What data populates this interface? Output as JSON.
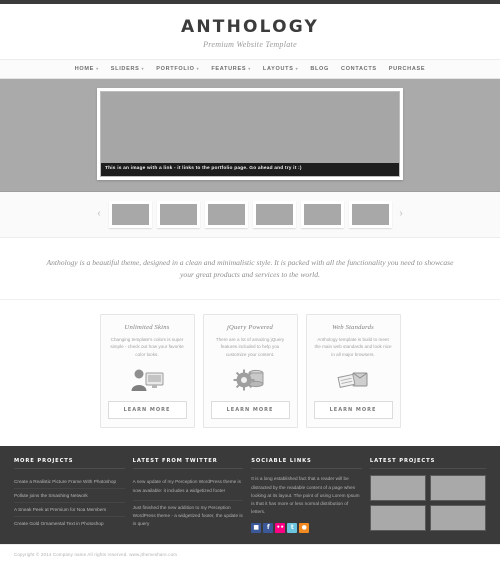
{
  "header": {
    "logo": "ANTHOLOGY",
    "tagline": "Premium Website Template"
  },
  "nav": {
    "items": [
      {
        "label": "HOME",
        "has_dropdown": true
      },
      {
        "label": "SLIDERS",
        "has_dropdown": true
      },
      {
        "label": "PORTFOLIO",
        "has_dropdown": true
      },
      {
        "label": "FEATURES",
        "has_dropdown": true
      },
      {
        "label": "LAYOUTS",
        "has_dropdown": true
      },
      {
        "label": "BLOG",
        "has_dropdown": false
      },
      {
        "label": "CONTACTS",
        "has_dropdown": false
      },
      {
        "label": "PURCHASE",
        "has_dropdown": false
      }
    ],
    "caret": "▾"
  },
  "hero": {
    "caption": "This is an image with a link - it links to the portfolio page. Go ahead and try it :)"
  },
  "carousel": {
    "prev": "‹",
    "next": "›",
    "thumb_count": 6
  },
  "intro": {
    "text": "Anthology is a beautiful theme, designed in a clean and minimalistic style. It is packed with all the functionality you need to showcase your great products and services to the world."
  },
  "features": {
    "boxes": [
      {
        "title": "Unlimited Skins",
        "text": "Changing template's colors is super simple - check out how your favorite color looks.",
        "icon": "person-monitor-icon",
        "button": "LEARN MORE"
      },
      {
        "title": "jQuery Powered",
        "text": "There are a lot of amazing jQuery features included to help you customize your content.",
        "icon": "gear-database-icon",
        "button": "LEARN MORE"
      },
      {
        "title": "Web Standards",
        "text": "Anthology template is build to meet the main web standards and look nice in all major browsers.",
        "icon": "documents-box-icon",
        "button": "LEARN MORE"
      }
    ]
  },
  "footer": {
    "more_projects": {
      "title": "MORE PROJECTS",
      "links": [
        "Create a Realistic Picture Frame With Photoshop",
        "Pollute joins the Smashing Network",
        "A Sneak Peek at Premium for Noa Members",
        "Create Gold Ornamental Text in Photoshop"
      ]
    },
    "twitter": {
      "title": "LATEST FROM TWITTER",
      "tweets": [
        "A new update of my Perception WordPress theme is now available: it includes a widgetized footer",
        "Just finished the new addition to my Perception WordPress theme - a widgetized footer, the update is in query"
      ]
    },
    "sociable": {
      "title": "SOCIABLE LINKS",
      "text": "It is a long established fact that a reader will be distracted by the readable content of a page when looking at its layout. The point of using Lorem Ipsum is that it has more or less normal distribution of letters.",
      "icons": [
        {
          "name": "delicious-icon",
          "glyph": "■",
          "color": "#3b5998"
        },
        {
          "name": "facebook-icon",
          "glyph": "f",
          "color": "#3b5998"
        },
        {
          "name": "flickr-icon",
          "glyph": "••",
          "color": "#ff0084"
        },
        {
          "name": "twitter-icon",
          "glyph": "t",
          "color": "#6cc5de"
        },
        {
          "name": "rss-icon",
          "glyph": "●",
          "color": "#f28a21"
        }
      ]
    },
    "projects": {
      "title": "LATEST PROJECTS",
      "thumb_count": 4
    }
  },
  "copyright": {
    "text": "Copyright © 2014 Company name All rights reserved. www.jthemeshare.com"
  }
}
